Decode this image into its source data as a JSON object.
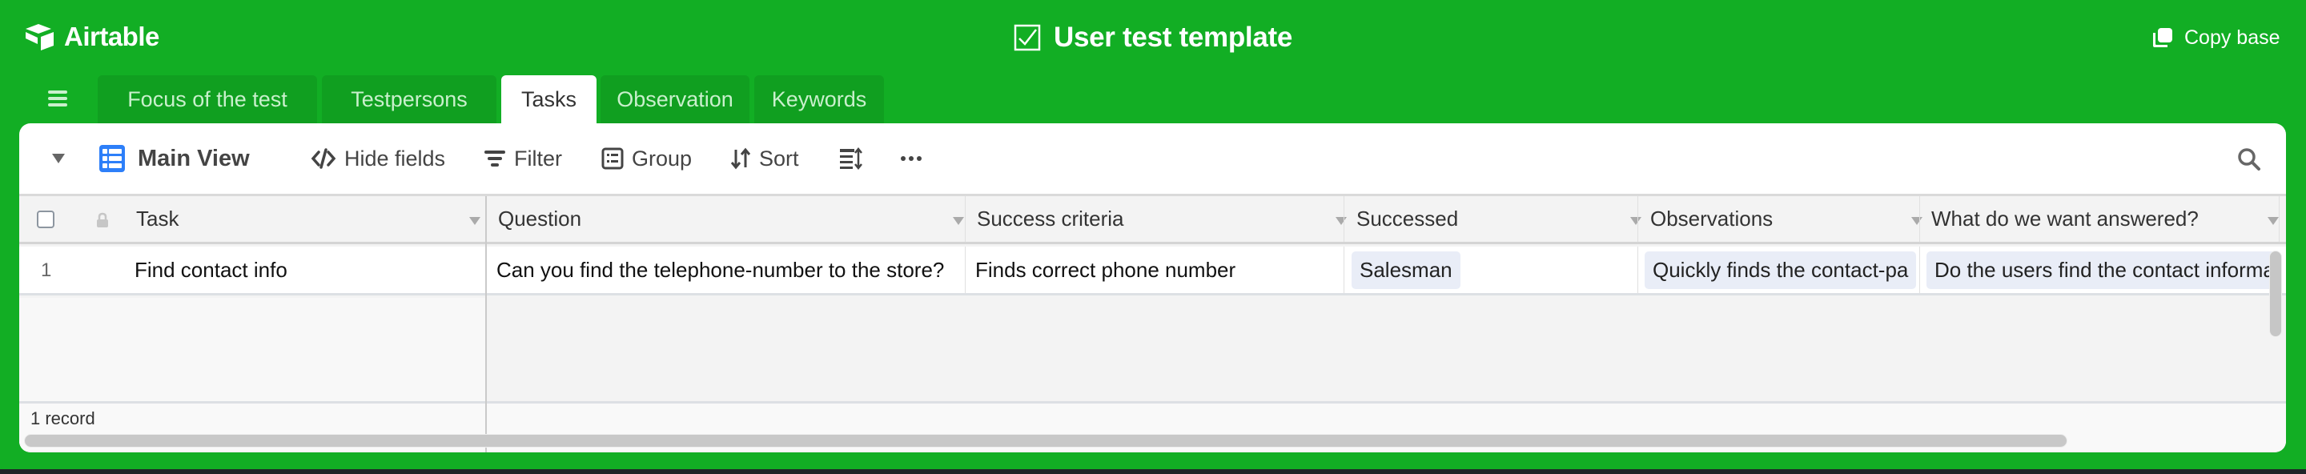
{
  "app": {
    "brand": "Airtable",
    "base_title": "User test template",
    "copy_base_label": "Copy base",
    "colors": {
      "brand_green": "#12ae24",
      "tab_inactive": "#109f20",
      "view_icon_blue": "#2d7ff9",
      "pill_bg": "#e9edf7"
    }
  },
  "tabs": [
    {
      "label": "Focus of the test",
      "active": false
    },
    {
      "label": "Testpersons",
      "active": false
    },
    {
      "label": "Tasks",
      "active": true
    },
    {
      "label": "Observation",
      "active": false
    },
    {
      "label": "Keywords",
      "active": false
    }
  ],
  "toolbar": {
    "view_name": "Main View",
    "hide_fields": "Hide fields",
    "filter": "Filter",
    "group": "Group",
    "sort": "Sort",
    "icons": [
      "view-toggle-icon",
      "grid-view-icon",
      "hide-fields-icon",
      "filter-icon",
      "group-icon",
      "sort-icon",
      "row-height-icon",
      "more-icon",
      "search-icon"
    ]
  },
  "grid": {
    "columns": [
      {
        "name": "Task",
        "frozen": true
      },
      {
        "name": "Question"
      },
      {
        "name": "Success criteria"
      },
      {
        "name": "Successed"
      },
      {
        "name": "Observations"
      },
      {
        "name": "What do we want answered?"
      }
    ],
    "rows": [
      {
        "number": "1",
        "task": "Find contact info",
        "question": "Can you find the telephone-number to the store?",
        "success_criteria": "Finds correct phone number",
        "successed": "Salesman",
        "observations": "Quickly finds the contact-pa",
        "what_answered": "Do the users find the contact informa"
      }
    ],
    "record_count": "1 record"
  }
}
